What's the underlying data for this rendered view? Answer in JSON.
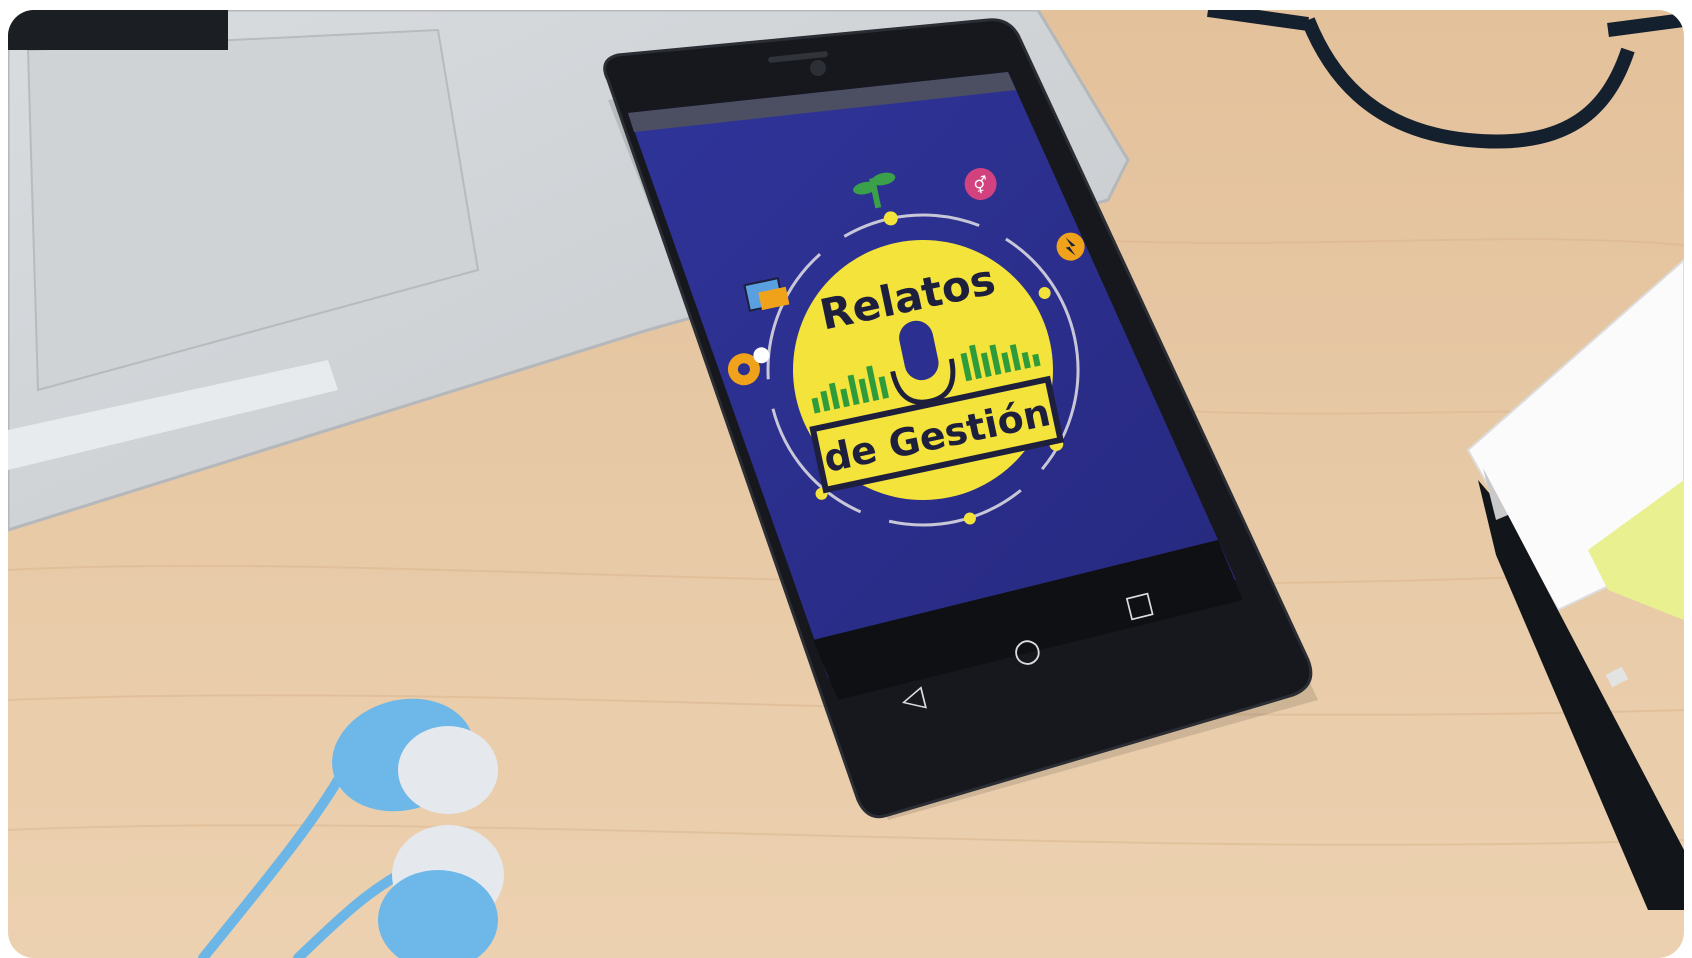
{
  "photo": {
    "subject": "smartphone-on-desk",
    "colors": {
      "desk": "#e7c8a4",
      "screen_bg": "#2b2f8f",
      "logo_yellow": "#f3e33b",
      "earbuds": "#6bb6e6"
    }
  },
  "app_logo": {
    "title_line1": "Relatos",
    "title_line2": "de Gestión"
  },
  "navigation_bar": {
    "back_glyph": "◁",
    "home_glyph": "○",
    "recents_glyph": "□"
  }
}
